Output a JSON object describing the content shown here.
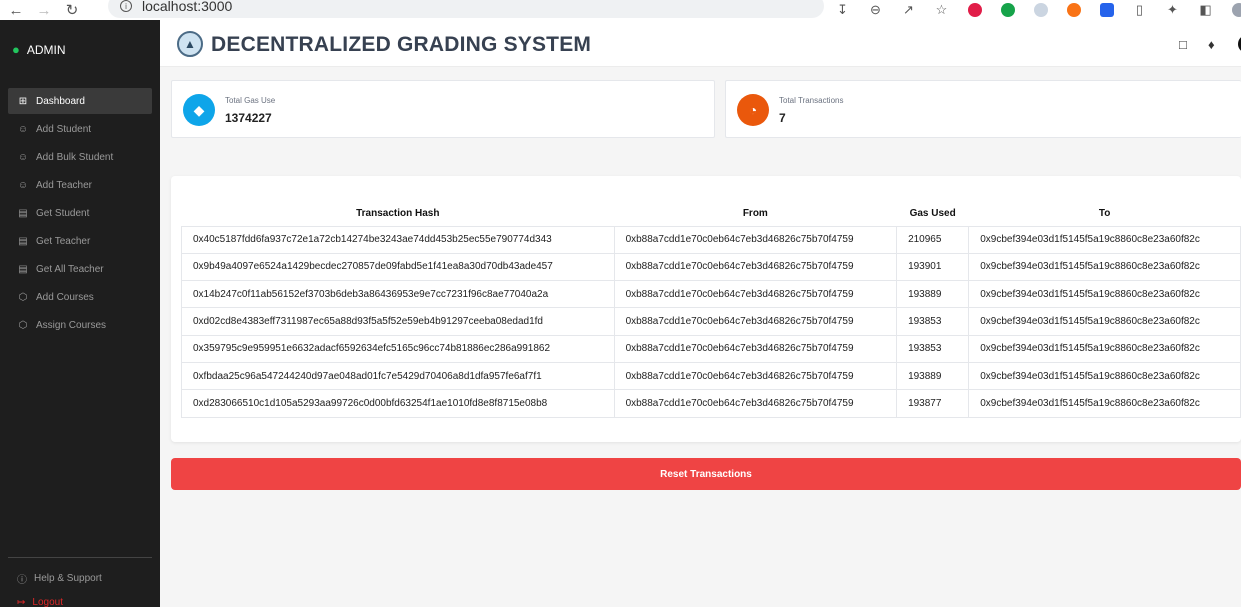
{
  "browser": {
    "url": "localhost:3000"
  },
  "sidebar": {
    "admin_label": "ADMIN",
    "items": [
      {
        "label": "Dashboard",
        "icon": "grid-icon",
        "active": true
      },
      {
        "label": "Add Student",
        "icon": "user-group-icon"
      },
      {
        "label": "Add Bulk Student",
        "icon": "user-group-icon"
      },
      {
        "label": "Add Teacher",
        "icon": "user-group-icon"
      },
      {
        "label": "Get Student",
        "icon": "document-icon"
      },
      {
        "label": "Get Teacher",
        "icon": "document-icon"
      },
      {
        "label": "Get All Teacher",
        "icon": "document-icon"
      },
      {
        "label": "Add Courses",
        "icon": "cube-icon"
      },
      {
        "label": "Assign Courses",
        "icon": "cube-icon"
      }
    ],
    "help_label": "Help & Support",
    "logout_label": "Logout"
  },
  "header": {
    "title": "DECENTRALIZED GRADING SYSTEM"
  },
  "stats": {
    "gas": {
      "label": "Total Gas Use",
      "value": "1374227",
      "color": "#0ea5e9",
      "icon": "ethereum-icon"
    },
    "transactions": {
      "label": "Total Transactions",
      "value": "7",
      "color": "#ea580c",
      "icon": "pie-chart-icon"
    }
  },
  "table": {
    "headers": [
      "Transaction Hash",
      "From",
      "Gas Used",
      "To"
    ],
    "rows": [
      [
        "0x40c5187fdd6fa937c72e1a72cb14274be3243ae74dd453b25ec55e790774d343",
        "0xb88a7cdd1e70c0eb64c7eb3d46826c75b70f4759",
        "210965",
        "0x9cbef394e03d1f5145f5a19c8860c8e23a60f82c"
      ],
      [
        "0x9b49a4097e6524a1429becdec270857de09fabd5e1f41ea8a30d70db43ade457",
        "0xb88a7cdd1e70c0eb64c7eb3d46826c75b70f4759",
        "193901",
        "0x9cbef394e03d1f5145f5a19c8860c8e23a60f82c"
      ],
      [
        "0x14b247c0f11ab56152ef3703b6deb3a86436953e9e7cc7231f96c8ae77040a2a",
        "0xb88a7cdd1e70c0eb64c7eb3d46826c75b70f4759",
        "193889",
        "0x9cbef394e03d1f5145f5a19c8860c8e23a60f82c"
      ],
      [
        "0xd02cd8e4383eff7311987ec65a88d93f5a5f52e59eb4b91297ceeba08edad1fd",
        "0xb88a7cdd1e70c0eb64c7eb3d46826c75b70f4759",
        "193853",
        "0x9cbef394e03d1f5145f5a19c8860c8e23a60f82c"
      ],
      [
        "0x359795c9e959951e6632adacf6592634efc5165c96cc74b81886ec286a991862",
        "0xb88a7cdd1e70c0eb64c7eb3d46826c75b70f4759",
        "193853",
        "0x9cbef394e03d1f5145f5a19c8860c8e23a60f82c"
      ],
      [
        "0xfbdaa25c96a547244240d97ae048ad01fc7e5429d70406a8d1dfa957fe6af7f1",
        "0xb88a7cdd1e70c0eb64c7eb3d46826c75b70f4759",
        "193889",
        "0x9cbef394e03d1f5145f5a19c8860c8e23a60f82c"
      ],
      [
        "0xd283066510c1d105a5293aa99726c0d00bfd63254f1ae1010fd8e8f8715e08b8",
        "0xb88a7cdd1e70c0eb64c7eb3d46826c75b70f4759",
        "193877",
        "0x9cbef394e03d1f5145f5a19c8860c8e23a60f82c"
      ]
    ]
  },
  "reset_button": {
    "label": "Reset Transactions"
  }
}
